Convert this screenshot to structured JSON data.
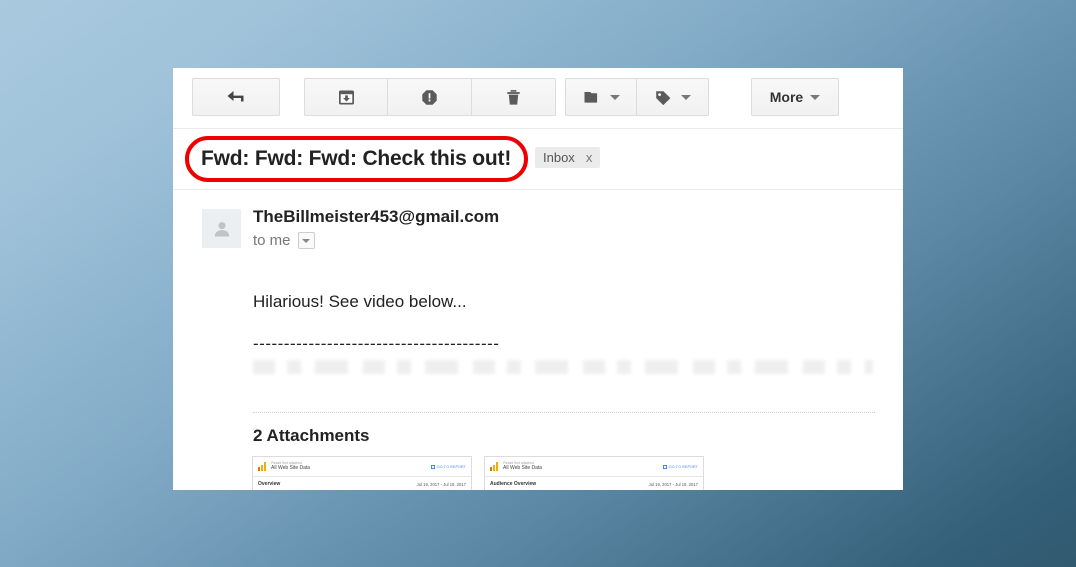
{
  "background": {
    "color_top_left": "#a9c9de",
    "color_bottom_right": "#33607a"
  },
  "toolbar": {
    "reply_label": "reply-arrow",
    "archive_label": "archive",
    "spam_label": "report-spam",
    "delete_label": "delete",
    "move_to_label": "move-to-folder",
    "labels_label": "labels",
    "more_label": "More"
  },
  "subject": {
    "text": "Fwd: Fwd: Fwd: Check this out!",
    "highlight_color": "#ee0000",
    "chip_label": "Inbox",
    "chip_remove": "x"
  },
  "message": {
    "sender_email": "TheBillmeister453@gmail.com",
    "recipient": "to me",
    "body_line": "Hilarious! See video below...",
    "body_separator": "----------------------------------------"
  },
  "attachments": {
    "title": "2 Attachments",
    "items": [
      {
        "account_label": "Please find attached",
        "property": "All Web Site Data",
        "report_name": "Overview",
        "date_range": "Jul 19, 2017 - Jul 19, 2017",
        "goto_label": "GO TO REPORT"
      },
      {
        "account_label": "Please find attached",
        "property": "All Web Site Data",
        "report_name": "Audience Overview",
        "date_range": "Jul 19, 2017 - Jul 19, 2017",
        "goto_label": "GO TO REPORT"
      }
    ]
  }
}
